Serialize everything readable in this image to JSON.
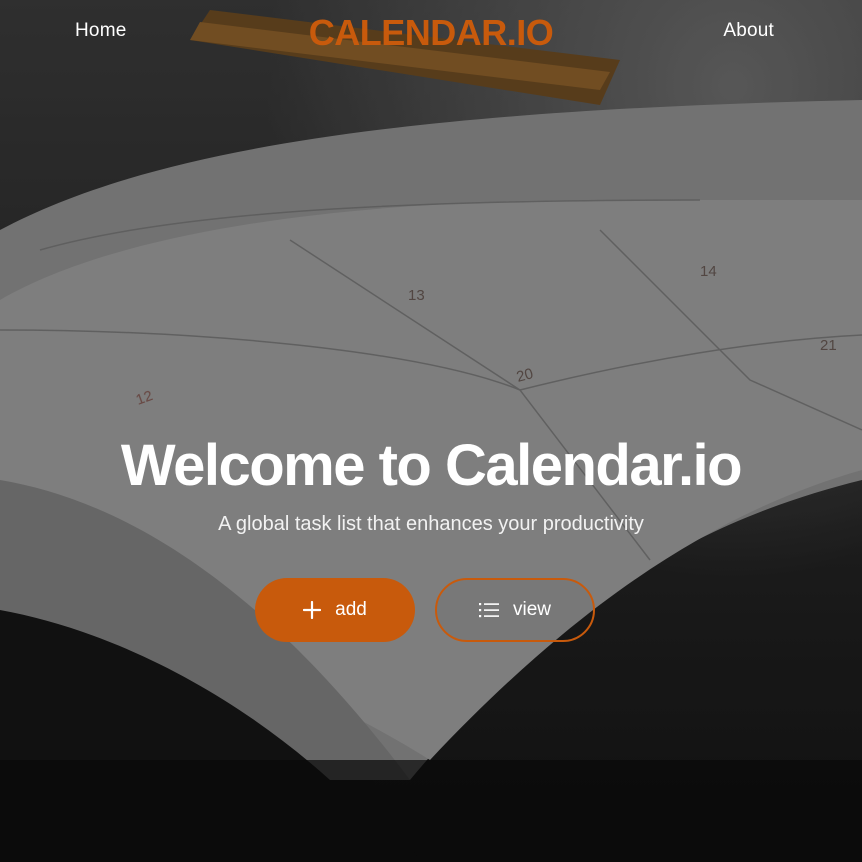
{
  "nav": {
    "home_label": "Home",
    "brand": "CALENDAR.IO",
    "about_label": "About"
  },
  "hero": {
    "title": "Welcome to Calendar.io",
    "subtitle": "A global task list that enhances your productivity",
    "add_label": "add",
    "view_label": "view"
  },
  "background": {
    "planner_dates": [
      "13",
      "20",
      "14",
      "21",
      "12"
    ]
  },
  "colors": {
    "accent": "#c85a0c",
    "text": "#ffffff"
  },
  "icons": {
    "add": "plus-icon",
    "view": "list-icon"
  }
}
